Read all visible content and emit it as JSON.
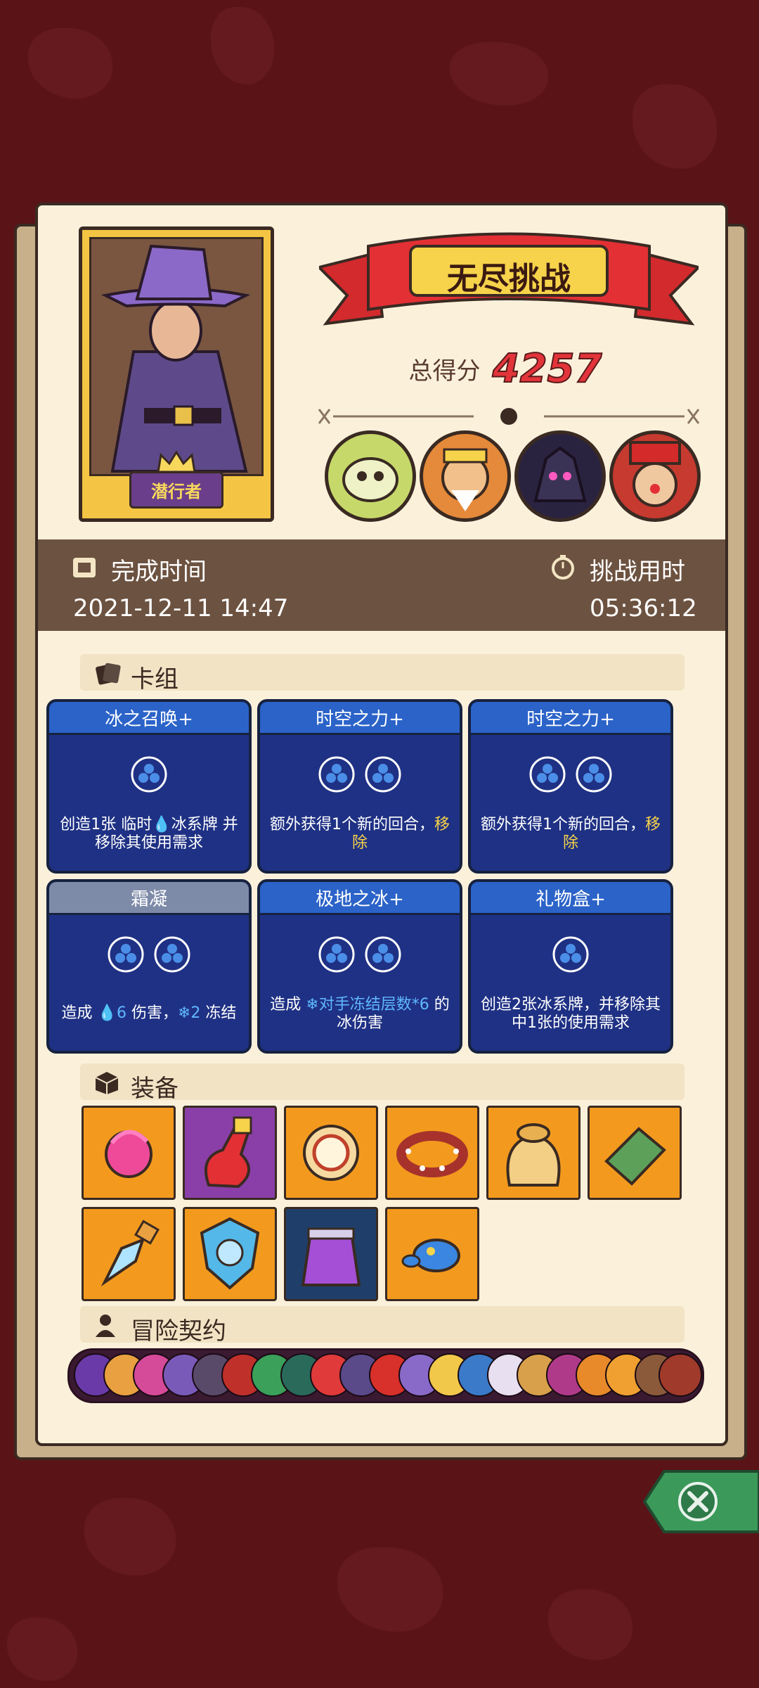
{
  "character": {
    "name": "潜行者"
  },
  "banner": {
    "title": "无尽挑战"
  },
  "score": {
    "label": "总得分",
    "value": "4257"
  },
  "completion": {
    "time_label": "完成时间",
    "time_value": "2021-12-11 14:47",
    "duration_label": "挑战用时",
    "duration_value": "05:36:12"
  },
  "sections": {
    "deck": "卡组",
    "equipment": "装备",
    "contracts": "冒险契约"
  },
  "cards": [
    {
      "title": "冰之召唤+",
      "orbs": 1,
      "desc_parts": [
        "创造1张 临时",
        "冰系牌 并移除其使用需求"
      ]
    },
    {
      "title": "时空之力+",
      "orbs": 2,
      "desc_a": "额外获得1个新的回合，",
      "desc_b": "移除"
    },
    {
      "title": "时空之力+",
      "orbs": 2,
      "desc_a": "额外获得1个新的回合，",
      "desc_b": "移除"
    },
    {
      "title": "霜凝",
      "orbs": 2,
      "desc_a": "造成",
      "desc_b": "6",
      "desc_c": "伤害，",
      "desc_d": "2",
      "desc_e": "冻结"
    },
    {
      "title": "极地之冰+",
      "orbs": 2,
      "desc_a": "造成",
      "desc_b": "对手冻结层数*6",
      "desc_c": "的冰伤害"
    },
    {
      "title": "礼物盒+",
      "orbs": 1,
      "desc": "创造2张冰系牌，并移除其中1张的使用需求"
    }
  ],
  "colors": {
    "accent": "#e2343a",
    "card_bg": "#1f3184",
    "card_header": "#2b63c8",
    "panel_bg": "#fbf1db",
    "page_bg": "#5a1418"
  },
  "equipment_icons": [
    "flame-orb-icon",
    "red-potion-icon",
    "shield-ring-icon",
    "spiked-collar-icon",
    "gold-sack-icon",
    "green-tome-icon",
    "ice-crystal-icon",
    "frost-shield-icon",
    "purple-jug-icon",
    "blue-slime-icon"
  ],
  "boss_icons": [
    "skeleton-boss-icon",
    "sage-boss-icon",
    "shadow-boss-icon",
    "clown-boss-icon"
  ]
}
